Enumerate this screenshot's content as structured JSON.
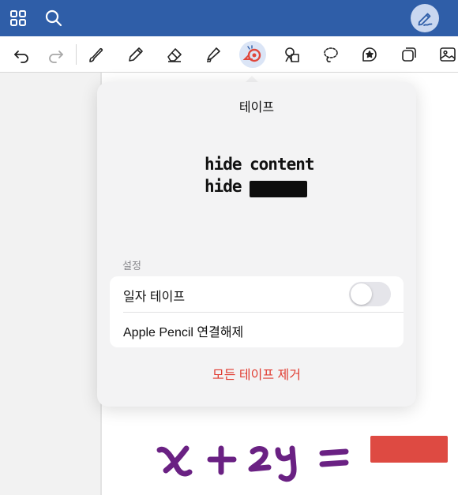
{
  "topbar": {
    "icons": [
      "grid-icon",
      "search-icon",
      "pen-profile-icon"
    ],
    "colors": {
      "bar": "#2f5ea8",
      "avatar_bg": "#c9d7f0"
    }
  },
  "toolbar": {
    "tools": [
      "undo-icon",
      "redo-icon",
      "brush-icon",
      "pencil-icon",
      "eraser-icon",
      "highlighter-icon",
      "tape-icon",
      "shapes-icon",
      "lasso-icon",
      "sticker-icon",
      "elements-icon",
      "image-icon"
    ],
    "active_tool": "tape-icon",
    "colors": {
      "active_bg": "#dbe5f6",
      "tape_accent": "#e0463b"
    }
  },
  "popover": {
    "title": "테이프",
    "preview": {
      "line1_word1": "hide",
      "line1_word2": "content",
      "line2_word1": "hide"
    },
    "section_label": "설정",
    "settings": {
      "straight_tape_label": "일자 테이프",
      "straight_tape_enabled": false,
      "pencil_disconnect_label": "Apple Pencil 연결해제"
    },
    "remove_all_label": "모든 테이프 제거",
    "colors": {
      "destructive": "#e03c31"
    }
  },
  "canvas": {
    "handwriting": "x + 2y =",
    "colors": {
      "ink": "#6a2183",
      "redaction": "#de4a42"
    }
  }
}
